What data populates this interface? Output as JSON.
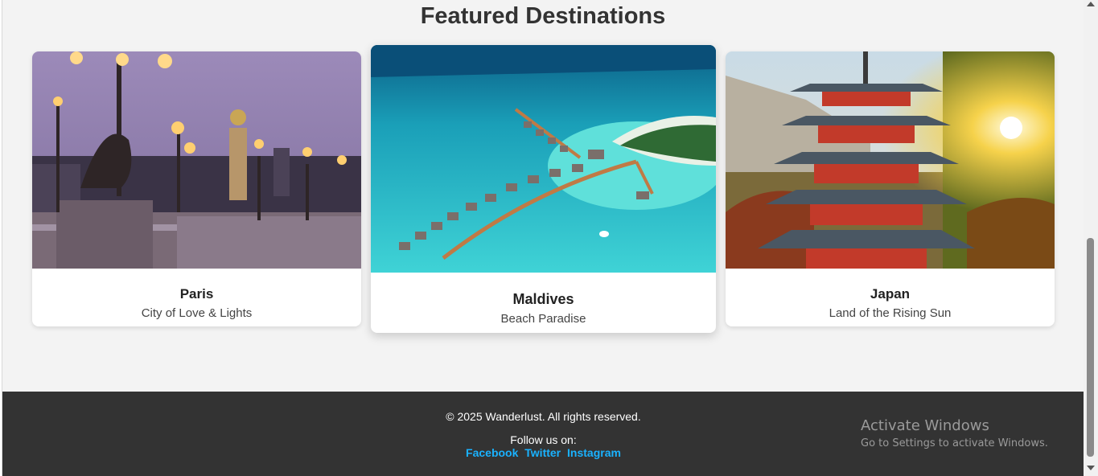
{
  "section": {
    "title": "Featured Destinations"
  },
  "destinations": [
    {
      "name": "Paris",
      "description": "City of Love & Lights",
      "image": "paris-bridge-photo"
    },
    {
      "name": "Maldives",
      "description": "Beach Paradise",
      "image": "maldives-overwater-villas-photo"
    },
    {
      "name": "Japan",
      "description": "Land of the Rising Sun",
      "image": "japan-pagoda-photo"
    }
  ],
  "footer": {
    "copyright": "© 2025 Wanderlust. All rights reserved.",
    "follow_label": "Follow us on:",
    "links": [
      "Facebook",
      "Twitter",
      "Instagram"
    ]
  },
  "watermark": {
    "title": "Activate Windows",
    "subtitle": "Go to Settings to activate Windows."
  },
  "colors": {
    "footer_bg": "#333333",
    "link": "#1ab2ff",
    "accent_water": "#1fc7d4"
  }
}
